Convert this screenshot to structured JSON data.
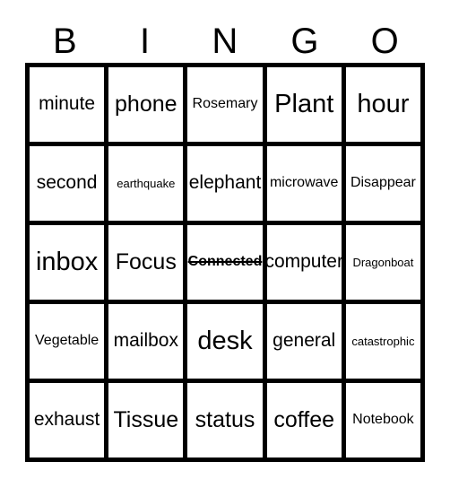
{
  "card": {
    "type": "bingo-card",
    "columns": 5,
    "rows": 5,
    "border_color": "#000000",
    "background_color": "#ffffff",
    "text_color": "#000000"
  },
  "header": {
    "letters": [
      {
        "label": "B"
      },
      {
        "label": "I"
      },
      {
        "label": "N"
      },
      {
        "label": "G"
      },
      {
        "label": "O"
      }
    ]
  },
  "grid": {
    "rows": [
      {
        "cells": [
          {
            "text": "minute",
            "size": "md",
            "marked": false
          },
          {
            "text": "phone",
            "size": "lg",
            "marked": false
          },
          {
            "text": "Rosemary",
            "size": "sm",
            "marked": false
          },
          {
            "text": "Plant",
            "size": "xl",
            "marked": false
          },
          {
            "text": "hour",
            "size": "xl",
            "marked": false
          }
        ]
      },
      {
        "cells": [
          {
            "text": "second",
            "size": "md",
            "marked": false
          },
          {
            "text": "earthquake",
            "size": "xs",
            "marked": false
          },
          {
            "text": "elephant",
            "size": "md",
            "marked": false
          },
          {
            "text": "microwave",
            "size": "sm",
            "marked": false
          },
          {
            "text": "Disappear",
            "size": "sm",
            "marked": false
          }
        ]
      },
      {
        "cells": [
          {
            "text": "inbox",
            "size": "xl",
            "marked": false
          },
          {
            "text": "Focus",
            "size": "lg",
            "marked": false
          },
          {
            "text": "Connected",
            "size": "sm",
            "marked": true
          },
          {
            "text": "computer",
            "size": "md",
            "marked": false
          },
          {
            "text": "Dragonboat",
            "size": "xs",
            "marked": false
          }
        ]
      },
      {
        "cells": [
          {
            "text": "Vegetable",
            "size": "sm",
            "marked": false
          },
          {
            "text": "mailbox",
            "size": "md",
            "marked": false
          },
          {
            "text": "desk",
            "size": "xl",
            "marked": false
          },
          {
            "text": "general",
            "size": "md",
            "marked": false
          },
          {
            "text": "catastrophic",
            "size": "xs",
            "marked": false
          }
        ]
      },
      {
        "cells": [
          {
            "text": "exhaust",
            "size": "md",
            "marked": false
          },
          {
            "text": "Tissue",
            "size": "lg",
            "marked": false
          },
          {
            "text": "status",
            "size": "lg",
            "marked": false
          },
          {
            "text": "coffee",
            "size": "lg",
            "marked": false
          },
          {
            "text": "Notebook",
            "size": "sm",
            "marked": false
          }
        ]
      }
    ]
  }
}
